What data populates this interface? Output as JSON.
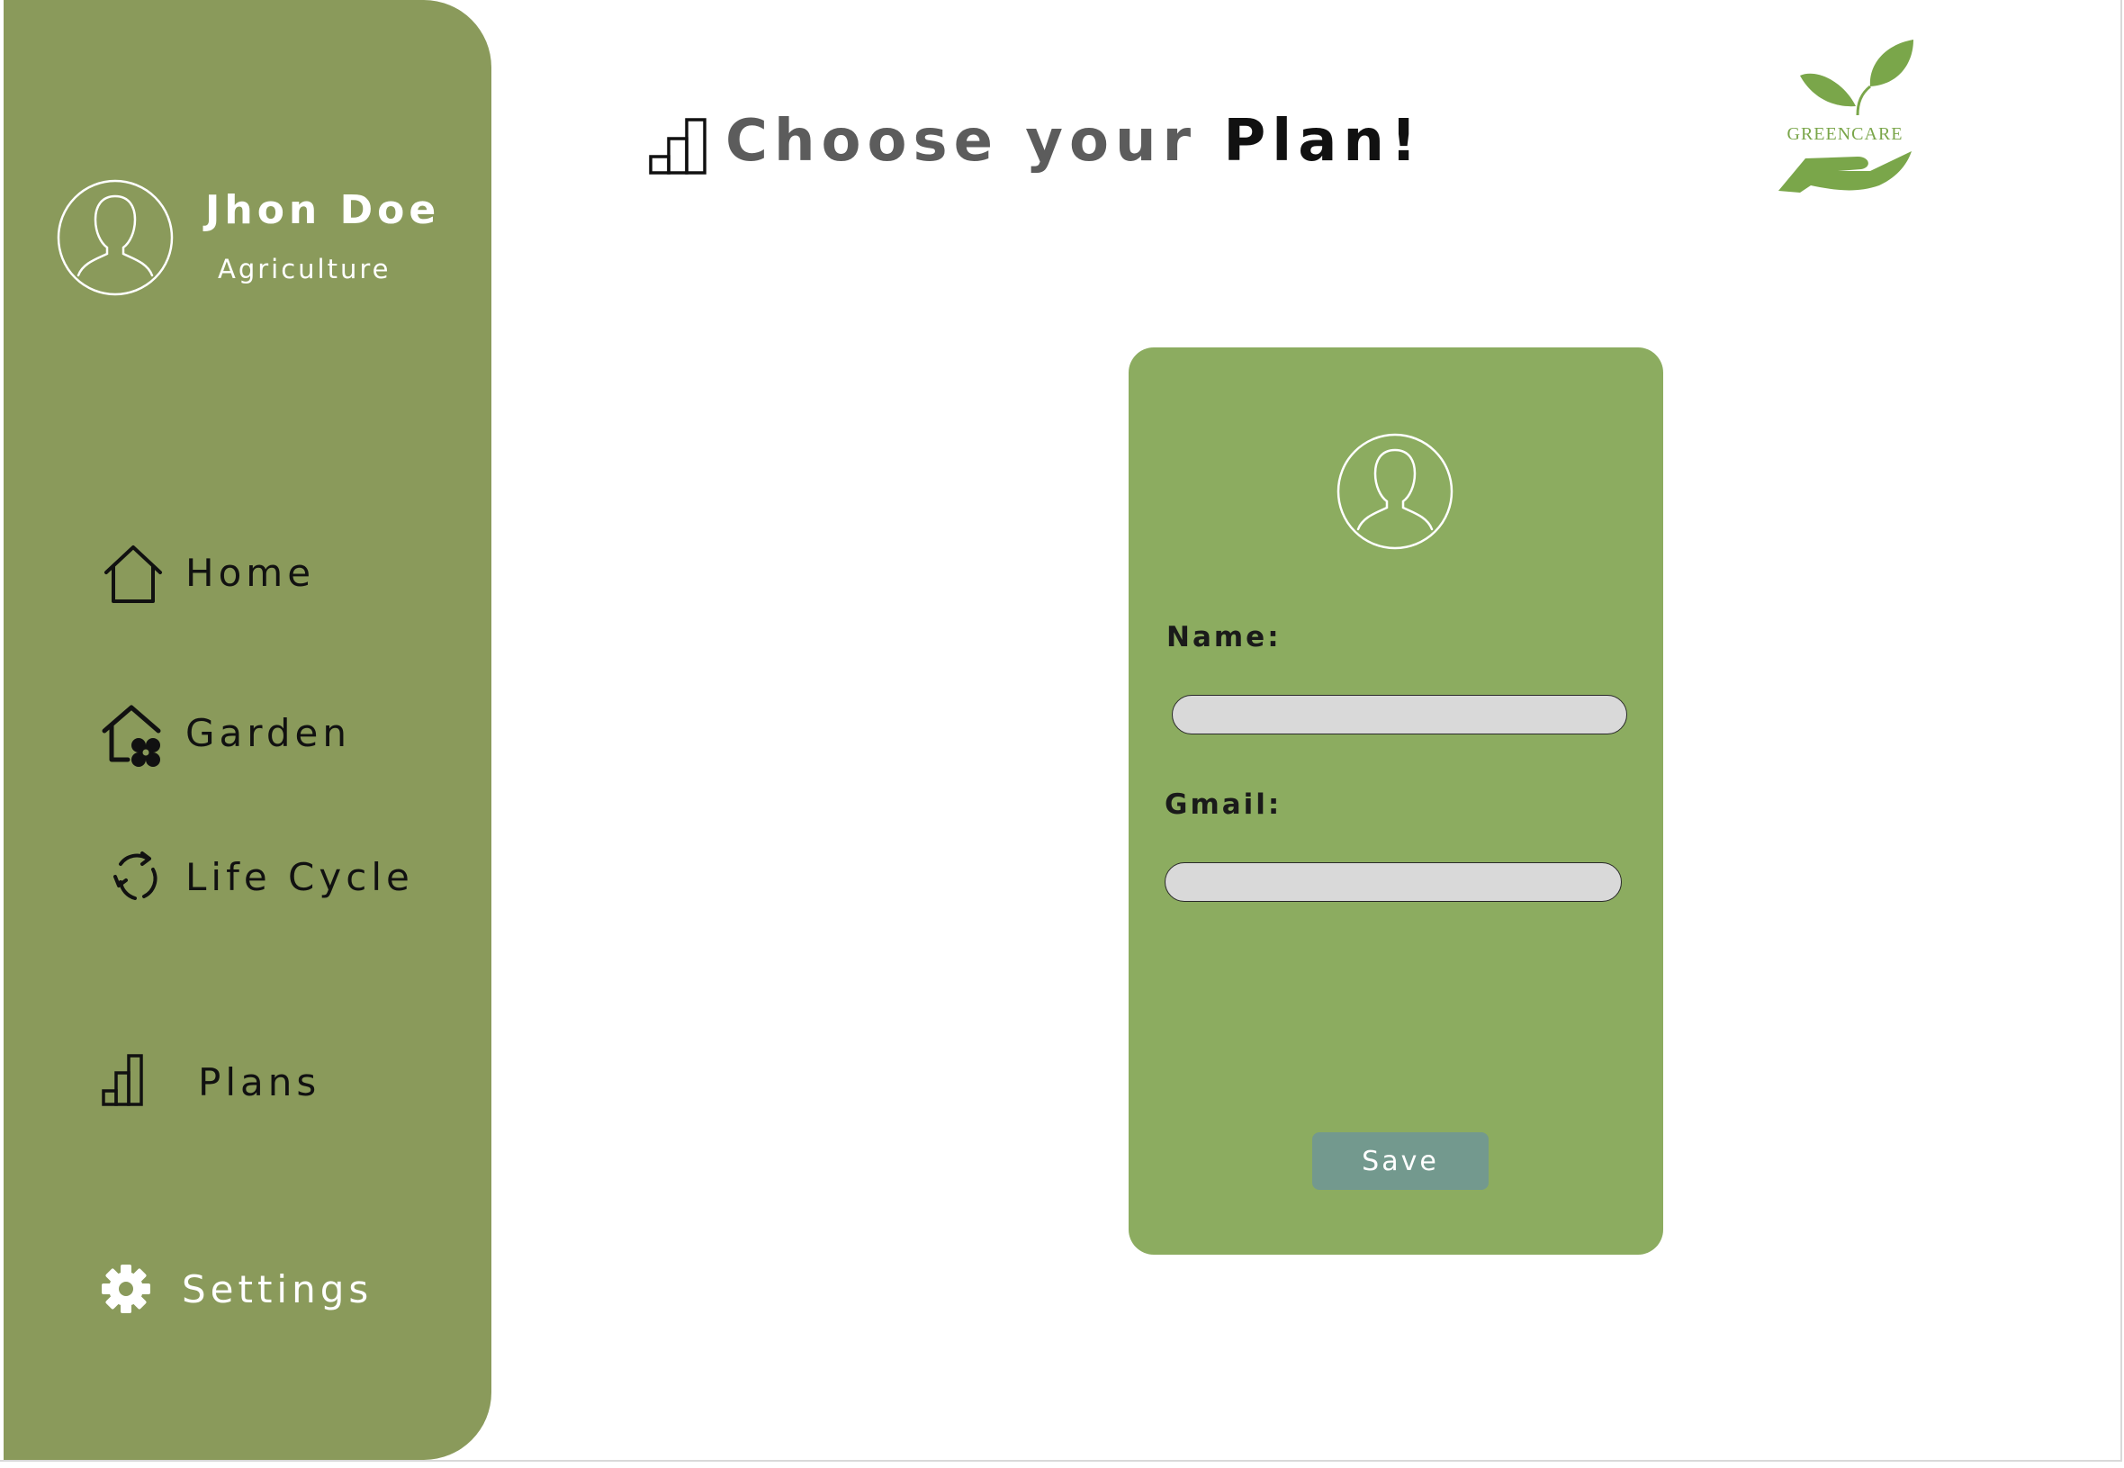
{
  "user": {
    "name": "Jhon Doe",
    "role": "Agriculture"
  },
  "sidebar": {
    "items": [
      {
        "label": "Home",
        "icon": "home-icon"
      },
      {
        "label": "Garden",
        "icon": "garden-house-icon"
      },
      {
        "label": "Life Cycle",
        "icon": "lifecycle-icon"
      },
      {
        "label": "Plans",
        "icon": "bar-chart-icon"
      },
      {
        "label": "Settings",
        "icon": "gear-icon"
      }
    ]
  },
  "header": {
    "title_prefix": "Choose your ",
    "title_accent": "Plan!",
    "title_icon": "bar-chart-icon"
  },
  "logo": {
    "text": "GREENCARE",
    "icon": "leaf-hand-icon"
  },
  "form": {
    "name_label": "Name:",
    "name_value": "",
    "gmail_label": "Gmail:",
    "gmail_value": "",
    "save_label": "Save"
  },
  "colors": {
    "sidebar": "#8a9a5b",
    "card": "#8cac60",
    "save_button": "#73998e",
    "input": "#d9d9d9",
    "logo": "#7aa64a"
  }
}
